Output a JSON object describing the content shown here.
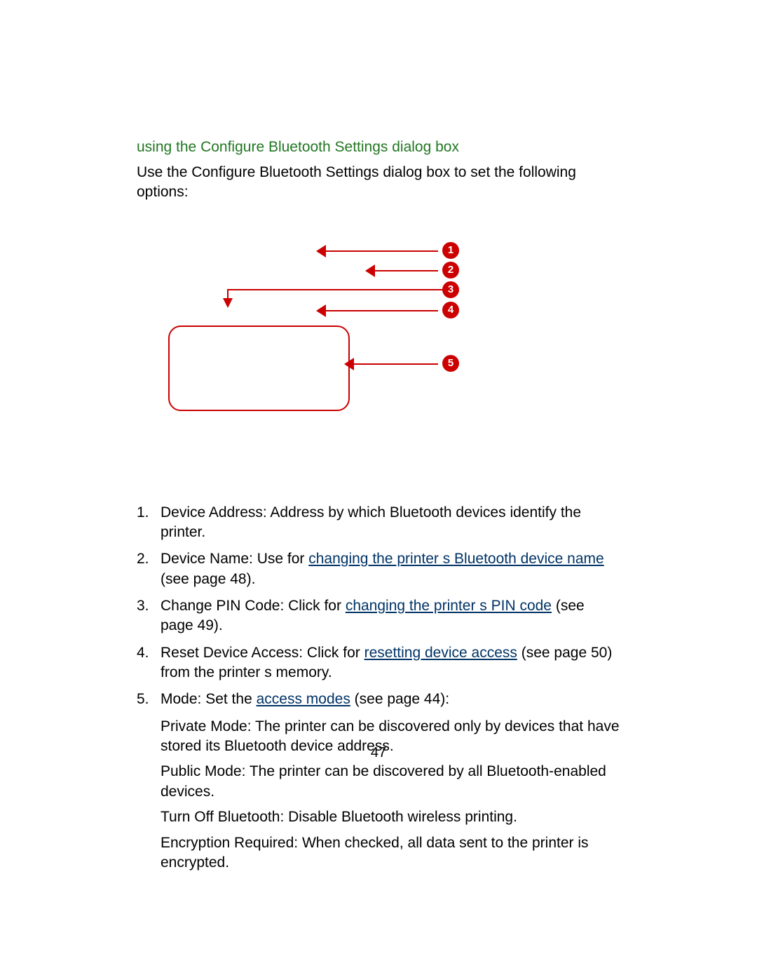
{
  "heading": "using the Configure Bluetooth Settings dialog box",
  "intro": "Use the Configure Bluetooth Settings dialog box to set the following options:",
  "callouts": [
    "1",
    "2",
    "3",
    "4",
    "5"
  ],
  "list": {
    "item1": {
      "num": "1.",
      "label": "Device Address",
      "colon": ": ",
      "body": "Address by which Bluetooth devices identify the printer."
    },
    "item2": {
      "num": "2.",
      "label": "Device Name",
      "colon": ": ",
      "lead": "Use for ",
      "link": "changing the printer s Bluetooth device name",
      "tail": " (see page 48)."
    },
    "item3": {
      "num": "3.",
      "label": "Change PIN Code",
      "colon": ": ",
      "lead": "Click for ",
      "link": "changing the printer s PIN code",
      "tail": " (see page 49)."
    },
    "item4": {
      "num": "4.",
      "label": "Reset Device Access",
      "colon": ": ",
      "lead": "Click for ",
      "link": "resetting device access",
      "tail": " (see page 50) from the printer s memory."
    },
    "item5": {
      "num": "5.",
      "label": "Mode",
      "colon": ": ",
      "lead": "Set the ",
      "link": "access modes",
      "tail": " (see page 44):"
    }
  },
  "sublist": {
    "private": {
      "label": "Private Mode",
      "colon": ": ",
      "body": "The printer can be discovered only by devices that have stored its Bluetooth device address."
    },
    "public": {
      "label": "Public Mode",
      "colon": ": ",
      "body": "The printer can be discovered by all Bluetooth-enabled devices."
    },
    "turnoff": {
      "label": "Turn Off Bluetooth",
      "colon": ": ",
      "body": "Disable Bluetooth wireless printing."
    },
    "encrypt": {
      "label": "Encryption Required",
      "colon": ": ",
      "body": "When checked, all data sent to the printer is encrypted."
    }
  },
  "pageNumber": "47"
}
